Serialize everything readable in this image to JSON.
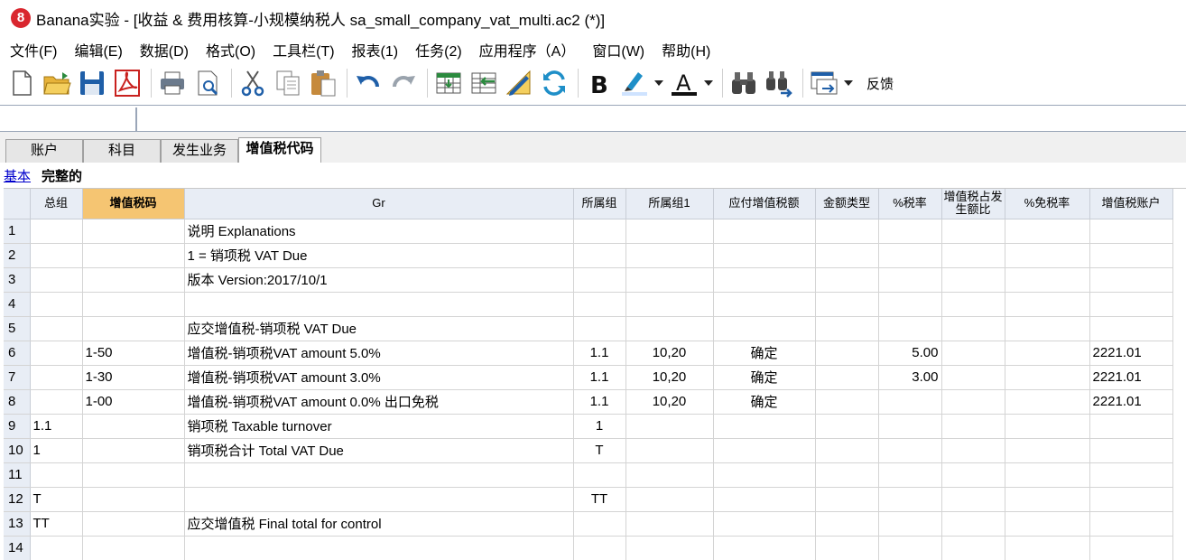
{
  "window": {
    "title": "Banana实验 - [收益 & 费用核算-小规模纳税人 sa_small_company_vat_multi.ac2 (*)]",
    "logo_text": "8"
  },
  "menu": [
    "文件(F)",
    "编辑(E)",
    "数据(D)",
    "格式(O)",
    "工具栏(T)",
    "报表(1)",
    "任务(2)",
    "应用程序（A）",
    "窗口(W)",
    "帮助(H)"
  ],
  "toolbar": {
    "feedback_label": "反馈"
  },
  "cellbar": {
    "cell_ref": "",
    "cell_value": ""
  },
  "tabs": [
    "账户",
    "科目",
    "发生业务",
    "增值税代码"
  ],
  "views": {
    "basic": "基本",
    "complete": "完整的"
  },
  "table": {
    "headers": [
      "",
      "总组",
      "增值税码",
      "Gr",
      "所属组",
      "所属组1",
      "应付增值税额",
      "金额类型",
      "%税率",
      "增值税占发生额比",
      "%免税率",
      "增值税账户"
    ],
    "rows": [
      [
        "1",
        "",
        "",
        "说明 Explanations",
        "",
        "",
        "",
        "",
        "",
        "",
        "",
        ""
      ],
      [
        "2",
        "",
        "",
        "1 = 销项税 VAT Due",
        "",
        "",
        "",
        "",
        "",
        "",
        "",
        ""
      ],
      [
        "3",
        "",
        "",
        "版本 Version:2017/10/1",
        "",
        "",
        "",
        "",
        "",
        "",
        "",
        ""
      ],
      [
        "4",
        "",
        "",
        "",
        "",
        "",
        "",
        "",
        "",
        "",
        "",
        ""
      ],
      [
        "5",
        "",
        "",
        "应交增值税-销项税 VAT Due",
        "",
        "",
        "",
        "",
        "",
        "",
        "",
        ""
      ],
      [
        "6",
        "",
        "1-50",
        "增值税-销项税VAT amount 5.0%",
        "1.1",
        "10,20",
        "确定",
        "",
        "5.00",
        "",
        "",
        "2221.01"
      ],
      [
        "7",
        "",
        "1-30",
        "增值税-销项税VAT amount 3.0%",
        "1.1",
        "10,20",
        "确定",
        "",
        "3.00",
        "",
        "",
        "2221.01"
      ],
      [
        "8",
        "",
        "1-00",
        "增值税-销项税VAT amount 0.0% 出口免税",
        "1.1",
        "10,20",
        "确定",
        "",
        "",
        "",
        "",
        "2221.01"
      ],
      [
        "9",
        "1.1",
        "",
        "销项税 Taxable turnover",
        "1",
        "",
        "",
        "",
        "",
        "",
        "",
        ""
      ],
      [
        "10",
        "1",
        "",
        "销项税合计 Total VAT Due",
        "T",
        "",
        "",
        "",
        "",
        "",
        "",
        ""
      ],
      [
        "11",
        "",
        "",
        "",
        "",
        "",
        "",
        "",
        "",
        "",
        "",
        ""
      ],
      [
        "12",
        "T",
        "",
        "",
        "TT",
        "",
        "",
        "",
        "",
        "",
        "",
        ""
      ],
      [
        "13",
        "TT",
        "",
        "应交增值税 Final total for control",
        "",
        "",
        "",
        "",
        "",
        "",
        "",
        ""
      ],
      [
        "14",
        "",
        "",
        "",
        "",
        "",
        "",
        "",
        "",
        "",
        "",
        ""
      ]
    ]
  }
}
